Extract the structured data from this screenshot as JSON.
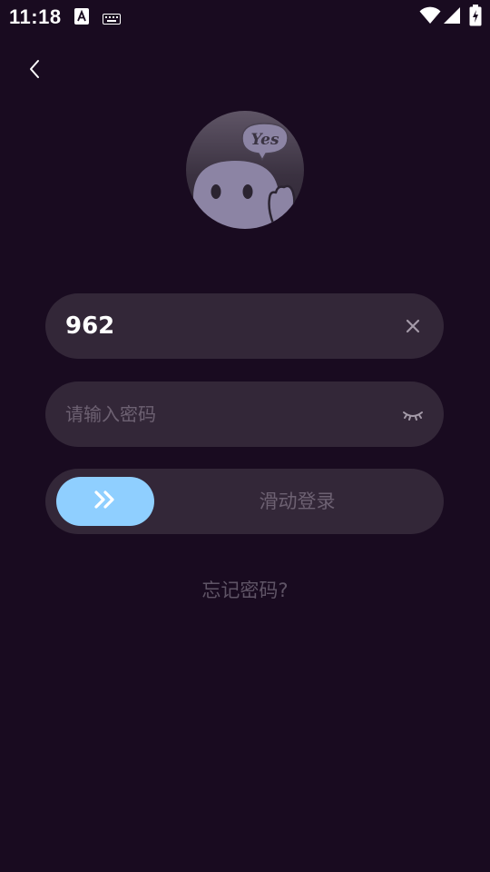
{
  "status_bar": {
    "time": "11:18",
    "icons": [
      "text-a-icon",
      "keyboard-icon",
      "wifi-icon",
      "signal-icon",
      "battery-charging-icon"
    ]
  },
  "nav": {
    "back_icon": "chevron-left-icon"
  },
  "avatar": {
    "speech_bubble_text": "Yes"
  },
  "username_field": {
    "value": "962",
    "clear_icon": "close-icon"
  },
  "password_field": {
    "placeholder": "请输入密码",
    "toggle_icon": "eye-closed-icon"
  },
  "slider": {
    "label": "滑动登录",
    "handle_icon": "double-chevron-right-icon",
    "progress": 0
  },
  "links": {
    "forgot_password": "忘记密码?"
  },
  "colors": {
    "background": "#190b20",
    "field_bg": "#332738",
    "accent": "#8fcfff",
    "muted_text": "#6d6172"
  }
}
